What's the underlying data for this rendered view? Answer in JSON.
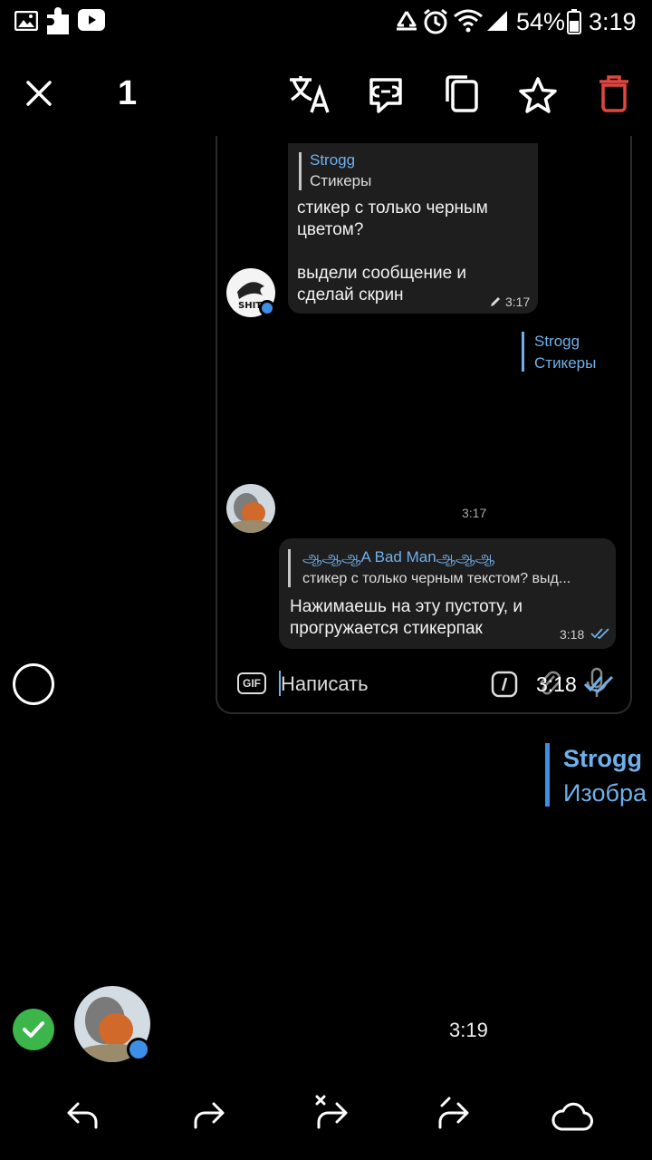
{
  "status_bar": {
    "battery": "54%",
    "time": "3:19"
  },
  "action_bar": {
    "selected_count": "1"
  },
  "screenshot": {
    "msg1": {
      "reply_name": "Strogg",
      "reply_text": "Стикеры",
      "text_line1": "стикер с только черным",
      "text_line2": "цветом?",
      "text_line3": "выдели сообщение и",
      "text_line4": "сделай скрин",
      "time": "3:17"
    },
    "reply_ref": {
      "name": "Strogg",
      "text": "Стикеры"
    },
    "sticker_time": "3:17",
    "msg2": {
      "reply_name": "ஆஆஆA Bad Manஆஆஆ",
      "reply_text": "стикер с только черным текстом?  выд...",
      "text_line1": "Нажимаешь на эту пустоту, и",
      "text_line2": "прогружается стикерпак",
      "time": "3:18"
    },
    "input": {
      "gif": "GIF",
      "placeholder": "Написать",
      "overlay_time": "3:18"
    }
  },
  "reply_preview": {
    "name": "Strogg",
    "text": "Изобра"
  },
  "message_time": "3:19",
  "colors": {
    "accent": "#6fb0ea",
    "delete": "#e0473e",
    "check": "#3cb54a",
    "online": "#3d8ee6"
  }
}
